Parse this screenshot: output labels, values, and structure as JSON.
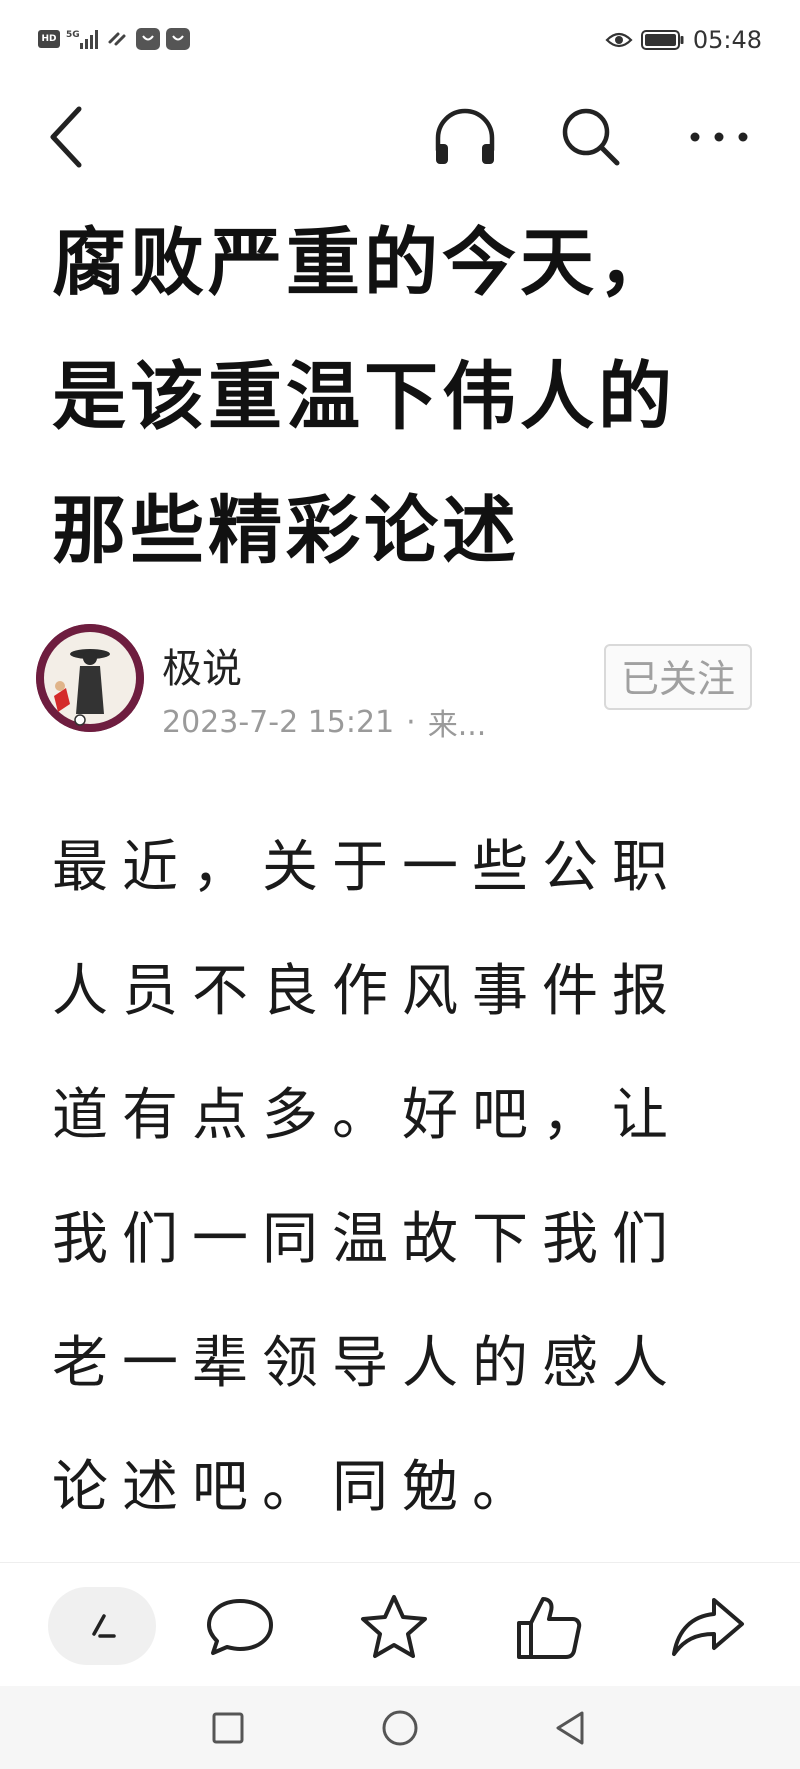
{
  "status_bar": {
    "hd_label": "HD",
    "network_label": "5G",
    "time": "05:48",
    "icons": [
      "hd-icon",
      "signal-5g-icon",
      "link-icon",
      "app-notification-icon",
      "app-notification-icon",
      "eye-icon",
      "battery-icon"
    ]
  },
  "nav": {
    "back_icon": "chevron-left-icon",
    "listen_icon": "headphones-icon",
    "search_icon": "search-icon",
    "more_icon": "more-horizontal-icon"
  },
  "article": {
    "title_lines": [
      "腐败严重的今天，",
      "是该重温下伟人的",
      "那些精彩论述"
    ],
    "body_lines": [
      "最近，关于一些公职",
      "人员不良作风事件报",
      "道有点多。好吧，让",
      "我们一同温故下我们",
      "老一辈领导人的感人",
      "论述吧。同勉。"
    ]
  },
  "author": {
    "name": "极说",
    "datetime": "2023-7-2 15:21",
    "separator": "·",
    "source_truncated": "来...",
    "follow_label": "已关注",
    "avatar_icon": "author-avatar"
  },
  "actions": {
    "comment_input_icon": "write-comment-icon",
    "comment_icon": "comment-icon",
    "favorite_icon": "star-icon",
    "like_icon": "thumbs-up-icon",
    "share_icon": "share-icon"
  },
  "system_nav": {
    "recents_icon": "square-icon",
    "home_icon": "circle-icon",
    "back_icon": "triangle-back-icon"
  },
  "colors": {
    "text_primary": "#111111",
    "text_secondary": "#9a9a9a",
    "follow_border": "#d9d9d9",
    "avatar_ring": "#6e1d3f",
    "icon_stroke": "#222222"
  }
}
